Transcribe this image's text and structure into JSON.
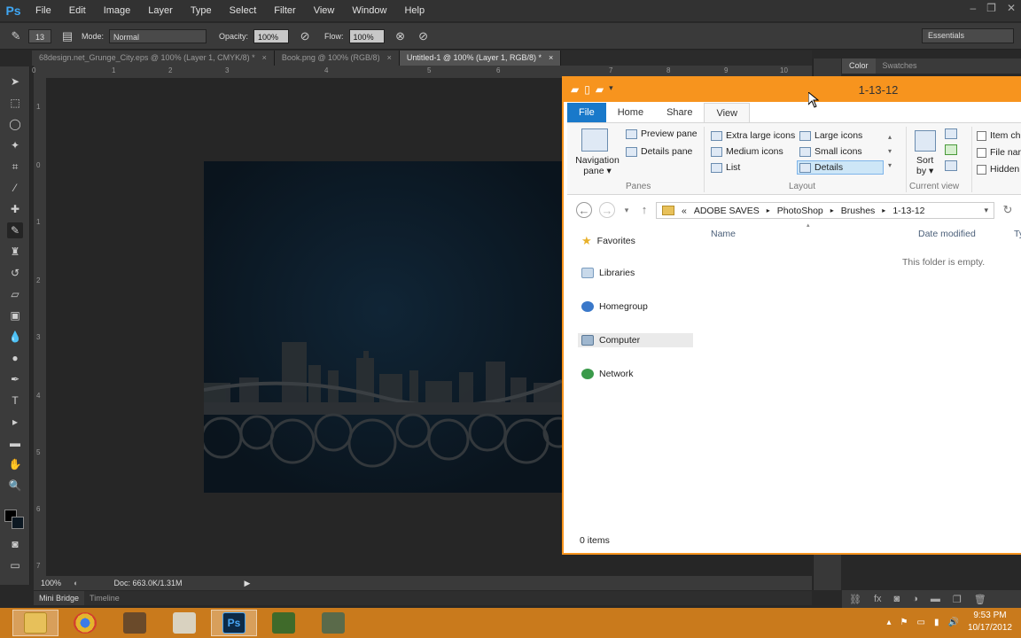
{
  "photoshop": {
    "logo": "Ps",
    "menu": [
      "File",
      "Edit",
      "Image",
      "Layer",
      "Type",
      "Select",
      "Filter",
      "View",
      "Window",
      "Help"
    ],
    "options": {
      "brush_size": "13",
      "mode_label": "Mode:",
      "mode_value": "Normal",
      "opacity_label": "Opacity:",
      "opacity_value": "100%",
      "flow_label": "Flow:",
      "flow_value": "100%"
    },
    "workspace": "Essentials",
    "doc_tabs": [
      {
        "label": "68design.net_Grunge_City.eps @ 100% (Layer 1, CMYK/8) *",
        "close": "×"
      },
      {
        "label": "Book.png @ 100% (RGB/8)",
        "close": "×"
      },
      {
        "label": "Untitled-1 @ 100% (Layer 1, RGB/8) *",
        "close": "×"
      }
    ],
    "ruler_top_ticks": [
      "0",
      "1",
      "2",
      "3",
      "4",
      "5",
      "6",
      "7",
      "8",
      "9",
      "10"
    ],
    "ruler_left_ticks": [
      "1",
      "0",
      "1",
      "2",
      "3",
      "4",
      "5",
      "6",
      "7"
    ],
    "status": {
      "zoom": "100%",
      "doc": "Doc: 663.0K/1.31M"
    },
    "bottom_tabs": [
      "Mini Bridge",
      "Timeline"
    ],
    "panel_tabs": [
      "Color",
      "Swatches"
    ]
  },
  "explorer": {
    "title": "1-13-12",
    "ribbon_tabs": [
      "File",
      "Home",
      "Share",
      "View"
    ],
    "panes": {
      "navigation_pane": "Navigation",
      "navigation_pane2": "pane",
      "preview_pane": "Preview pane",
      "details_pane": "Details pane",
      "label": "Panes"
    },
    "layout": {
      "extra_large": "Extra large icons",
      "large": "Large icons",
      "medium": "Medium icons",
      "small": "Small icons",
      "list": "List",
      "details": "Details",
      "label": "Layout"
    },
    "current_view": {
      "sort_by": "Sort",
      "sort_by2": "by",
      "label": "Current view"
    },
    "show_hide": {
      "item_check": "Item ch",
      "file_name": "File nar",
      "hidden": "Hidden"
    },
    "address": [
      "«",
      "ADOBE SAVES",
      "PhotoShop",
      "Brushes",
      "1-13-12"
    ],
    "nav_items": [
      "Favorites",
      "Libraries",
      "Homegroup",
      "Computer",
      "Network"
    ],
    "columns": [
      "Name",
      "Date modified",
      "Ty"
    ],
    "empty_message": "This folder is empty.",
    "item_count": "0 items"
  },
  "taskbar": {
    "clock_time": "9:53 PM",
    "clock_date": "10/17/2012"
  }
}
